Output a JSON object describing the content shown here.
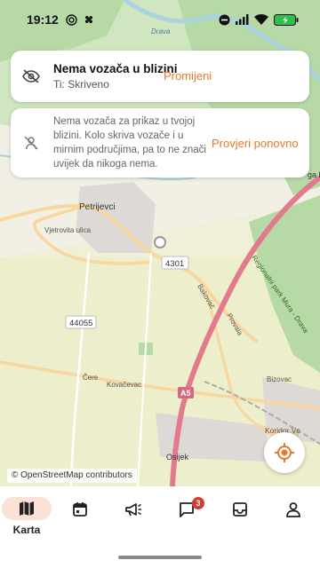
{
  "status_bar": {
    "time": "19:12",
    "left_icons": [
      "target-icon",
      "fan-icon"
    ],
    "right_icons": [
      "do-not-disturb-icon",
      "signal-icon",
      "wifi-icon",
      "battery-icon"
    ]
  },
  "map": {
    "labels": {
      "town": "Petrijevci",
      "street1": "Vjetrovita ulica",
      "road_number1": "4301",
      "road_number2": "44055",
      "road3": "Bakovač",
      "road4": "Provala",
      "road5": "Čere",
      "road6": "Kovačevac",
      "motorway": "A5",
      "area": "Koridor Vc",
      "city": "Osijek",
      "park": "Regionalni park Mura - Drava",
      "river": "Drava",
      "place": "Bizovac",
      "edge_letters": "ga\nb\nk"
    },
    "attribution": "© OpenStreetMap contributors"
  },
  "notice_card": {
    "title": "Nema vozača u blizini",
    "subtitle": "Ti: Skriveno",
    "action": "Promijeni",
    "icon": "eye-off-icon"
  },
  "info_card": {
    "text": "Nema vozača za prikaz u tvojoj blizini. Kolo skriva vozače i u mirnim područjima, pa to ne znači uvijek da nikoga nema.",
    "action": "Provjeri ponovno",
    "icon": "no-driver-icon"
  },
  "locate_button": {
    "icon": "locate-icon"
  },
  "nav": {
    "items": [
      {
        "label": "Karta",
        "icon": "map-icon",
        "active": true
      },
      {
        "label": "",
        "icon": "calendar-icon",
        "active": false
      },
      {
        "label": "",
        "icon": "megaphone-icon",
        "active": false
      },
      {
        "label": "",
        "icon": "chat-icon",
        "active": false,
        "badge": "3"
      },
      {
        "label": "",
        "icon": "inbox-icon",
        "active": false
      },
      {
        "label": "",
        "icon": "profile-icon",
        "active": false
      }
    ]
  },
  "colors": {
    "accent": "#e8772e",
    "active_pill": "#fbe1d6",
    "badge": "#d63a30",
    "motorway": "#e27a8e",
    "forest": "#b7d9a5"
  }
}
